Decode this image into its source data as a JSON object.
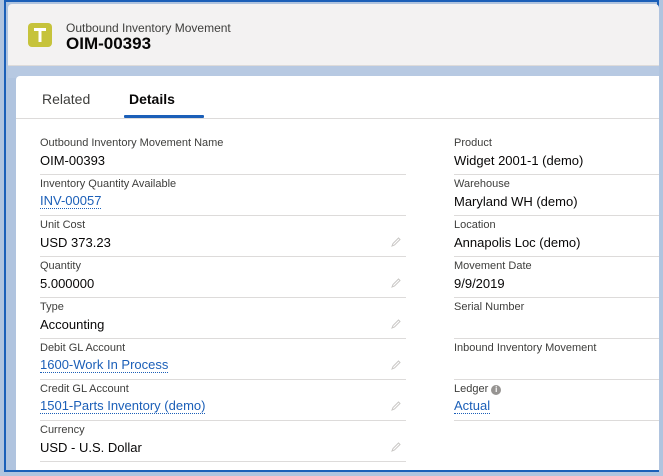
{
  "header": {
    "object_label": "Outbound Inventory Movement",
    "record_name": "OIM-00393"
  },
  "tabs": [
    {
      "label": "Related",
      "active": false
    },
    {
      "label": "Details",
      "active": true
    }
  ],
  "left_fields": [
    {
      "label": "Outbound Inventory Movement Name",
      "value": "OIM-00393",
      "link": false,
      "editable": false
    },
    {
      "label": "Inventory Quantity Available",
      "value": "INV-00057",
      "link": true,
      "editable": false
    },
    {
      "label": "Unit Cost",
      "value": "USD 373.23",
      "link": false,
      "editable": true
    },
    {
      "label": "Quantity",
      "value": "5.000000",
      "link": false,
      "editable": true
    },
    {
      "label": "Type",
      "value": "Accounting",
      "link": false,
      "editable": true
    },
    {
      "label": "Debit GL Account",
      "value": "1600-Work In Process",
      "link": true,
      "editable": true
    },
    {
      "label": "Credit GL Account",
      "value": "1501-Parts Inventory (demo)",
      "link": true,
      "editable": true
    },
    {
      "label": "Currency",
      "value": "USD - U.S. Dollar",
      "link": false,
      "editable": true
    }
  ],
  "right_fields": [
    {
      "label": "Product",
      "value": "Widget 2001-1 (demo)",
      "link": false
    },
    {
      "label": "Warehouse",
      "value": "Maryland WH (demo)",
      "link": false
    },
    {
      "label": "Location",
      "value": "Annapolis Loc (demo)",
      "link": false
    },
    {
      "label": "Movement Date",
      "value": "9/9/2019",
      "link": false
    },
    {
      "label": "Serial Number",
      "value": "",
      "link": false
    },
    {
      "label": "Inbound Inventory Movement",
      "value": "",
      "link": false
    },
    {
      "label": "Ledger",
      "value": "Actual",
      "link": true,
      "info": true
    }
  ],
  "colors": {
    "brand": "#1b5fb8",
    "object_icon": "#c6c33b",
    "border": "#dddbda"
  },
  "icons": {
    "object": "inventory-movement-icon",
    "edit": "pencil-icon",
    "info": "info-icon"
  }
}
